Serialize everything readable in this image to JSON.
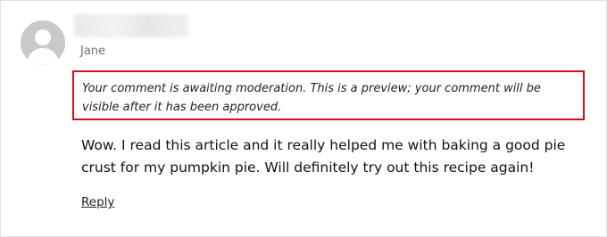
{
  "comment": {
    "author_name": "Jane",
    "moderation_notice": "Your comment is awaiting moderation. This is a preview; your comment will be visible after it has been approved.",
    "body": "Wow. I read this article and it really helped me with baking a good pie crust for my pumpkin pie. Will definitely try out this recipe again!",
    "reply_label": "Reply"
  },
  "colors": {
    "highlight_border": "#d0121a",
    "avatar_bg": "#c9c9c9",
    "meta_text": "#6f6f6f"
  },
  "icons": {
    "avatar": "default-avatar-icon"
  }
}
